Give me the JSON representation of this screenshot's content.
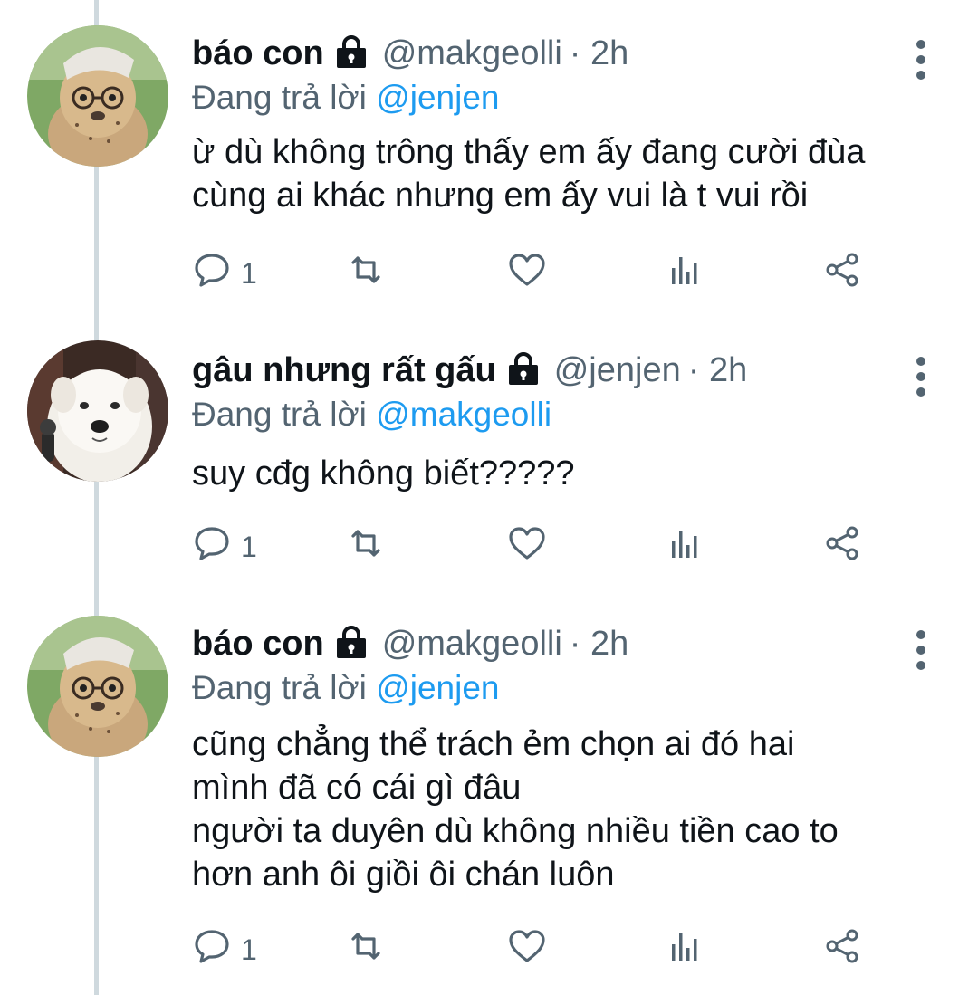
{
  "tweets": [
    {
      "name": "báo con",
      "handle": "@makgeolli",
      "time": "· 2h",
      "reply_prefix": "Đang trả lời",
      "reply_to": "@jenjen",
      "text": "ừ dù không trông thấy em ấy đang cười đùa\ncùng ai khác nhưng em ấy vui là t vui rồi",
      "reply_count": "1",
      "avatar": "cheetah-cub-avatar"
    },
    {
      "name": "gâu nhưng rất gấu",
      "handle": "@jenjen",
      "time": "· 2h",
      "reply_prefix": "Đang trả lời",
      "reply_to": "@makgeolli",
      "text": "suy cđg không biết?????",
      "reply_count": "1",
      "avatar": "white-dog-avatar"
    },
    {
      "name": "báo con",
      "handle": "@makgeolli",
      "time": "· 2h",
      "reply_prefix": "Đang trả lời",
      "reply_to": "@jenjen",
      "text": "cũng chẳng thể trách ẻm chọn ai đó hai\nmình đã có cái gì đâu\nngười ta duyên dù không nhiều tiền cao to\nhơn anh ôi giồi ôi chán luôn",
      "reply_count": "1",
      "avatar": "cheetah-cub-avatar"
    }
  ],
  "icons": {
    "reply": "comment-icon",
    "retweet": "retweet-icon",
    "like": "heart-icon",
    "views": "analytics-icon",
    "share": "share-icon",
    "lock": "lock-icon",
    "more": "more-vertical-icon"
  },
  "colors": {
    "link": "#1d9bf0",
    "secondary": "#536471",
    "thread_line": "#cfd9de"
  }
}
